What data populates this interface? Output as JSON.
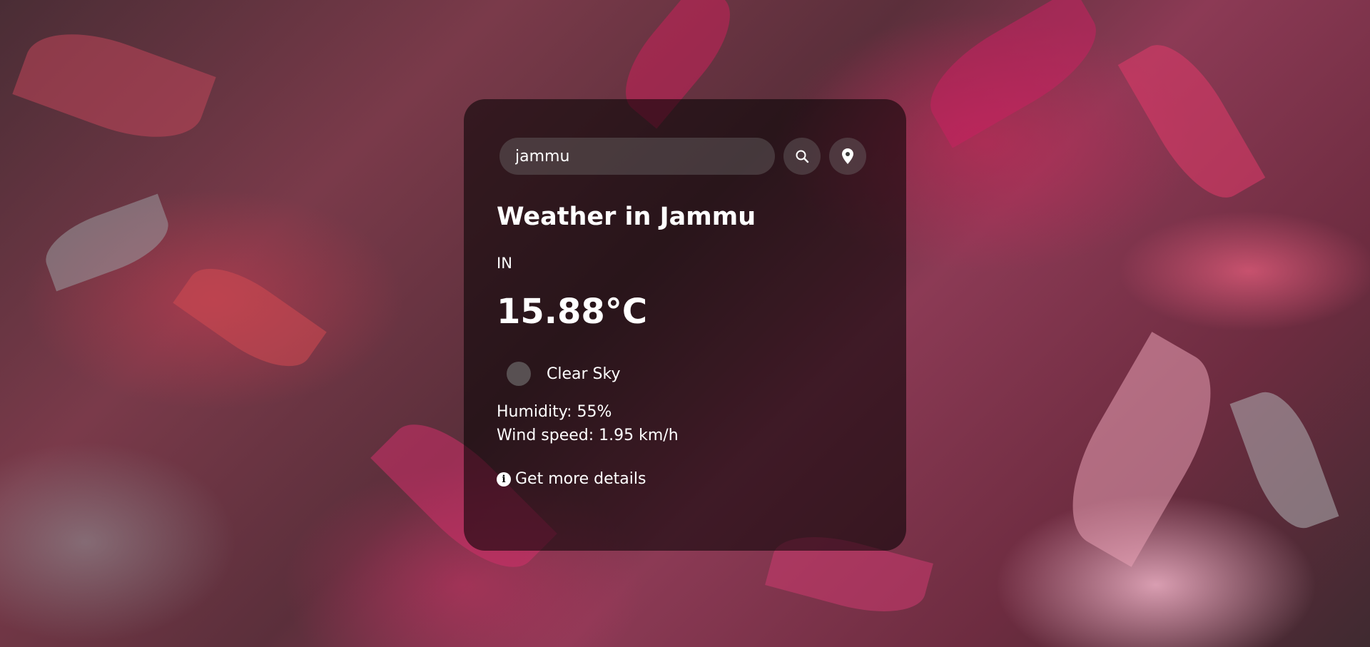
{
  "search": {
    "value": "jammu",
    "placeholder": "Search"
  },
  "weather": {
    "title": "Weather in Jammu",
    "country": "IN",
    "temperature": "15.88°C",
    "description": "Clear Sky",
    "humidity": "Humidity: 55%",
    "wind": "Wind speed: 1.95 km/h"
  },
  "links": {
    "details_label": "Get more details"
  },
  "icons": {
    "search": "search-icon",
    "location": "map-pin-icon",
    "weather": "weather-condition-icon",
    "info": "info-icon"
  },
  "colors": {
    "card_background": "#000000",
    "text": "#ffffff",
    "background_accent": "#c2185b"
  }
}
